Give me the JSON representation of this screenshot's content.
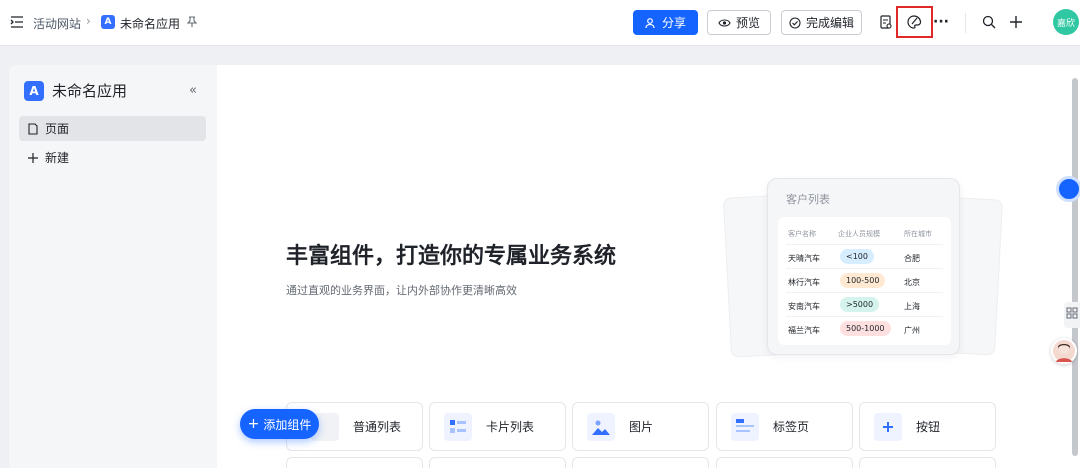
{
  "topbar": {
    "breadcrumb_site": "活动网站",
    "breadcrumb_app": "未命名应用",
    "share_label": "分享",
    "preview_label": "预览",
    "finish_label": "完成编辑",
    "avatar_text": "嘉欣"
  },
  "sidebar": {
    "app_name": "未命名应用",
    "items": [
      {
        "label": "页面",
        "icon": "page-icon",
        "active": true
      },
      {
        "label": "新建",
        "icon": "plus-icon",
        "active": false
      }
    ]
  },
  "hero": {
    "headline": "丰富组件，打造你的专属业务系统",
    "subline": "通过直观的业务界面，让内外部协作更清晰高效"
  },
  "preview_card": {
    "title": "客户列表",
    "columns": [
      "客户名称",
      "企业人员规模",
      "所在城市"
    ],
    "rows": [
      {
        "name": "天晴汽车",
        "size": "<100",
        "city": "合肥",
        "chip_color": "#d6ecff"
      },
      {
        "name": "林行汽车",
        "size": "100-500",
        "city": "北京",
        "chip_color": "#ffe9d2"
      },
      {
        "name": "安南汽车",
        "size": ">5000",
        "city": "上海",
        "chip_color": "#d3f3ec"
      },
      {
        "name": "福兰汽车",
        "size": "500-1000",
        "city": "广州",
        "chip_color": "#ffe0e0"
      }
    ]
  },
  "add_component_label": "添加组件",
  "components": [
    {
      "label": "普通列表",
      "icon": "list-icon"
    },
    {
      "label": "卡片列表",
      "icon": "card-list-icon"
    },
    {
      "label": "图片",
      "icon": "image-icon"
    },
    {
      "label": "标签页",
      "icon": "tabs-icon"
    },
    {
      "label": "按钮",
      "icon": "button-icon"
    }
  ],
  "colors": {
    "primary": "#1664ff",
    "highlight": "#e02828"
  }
}
